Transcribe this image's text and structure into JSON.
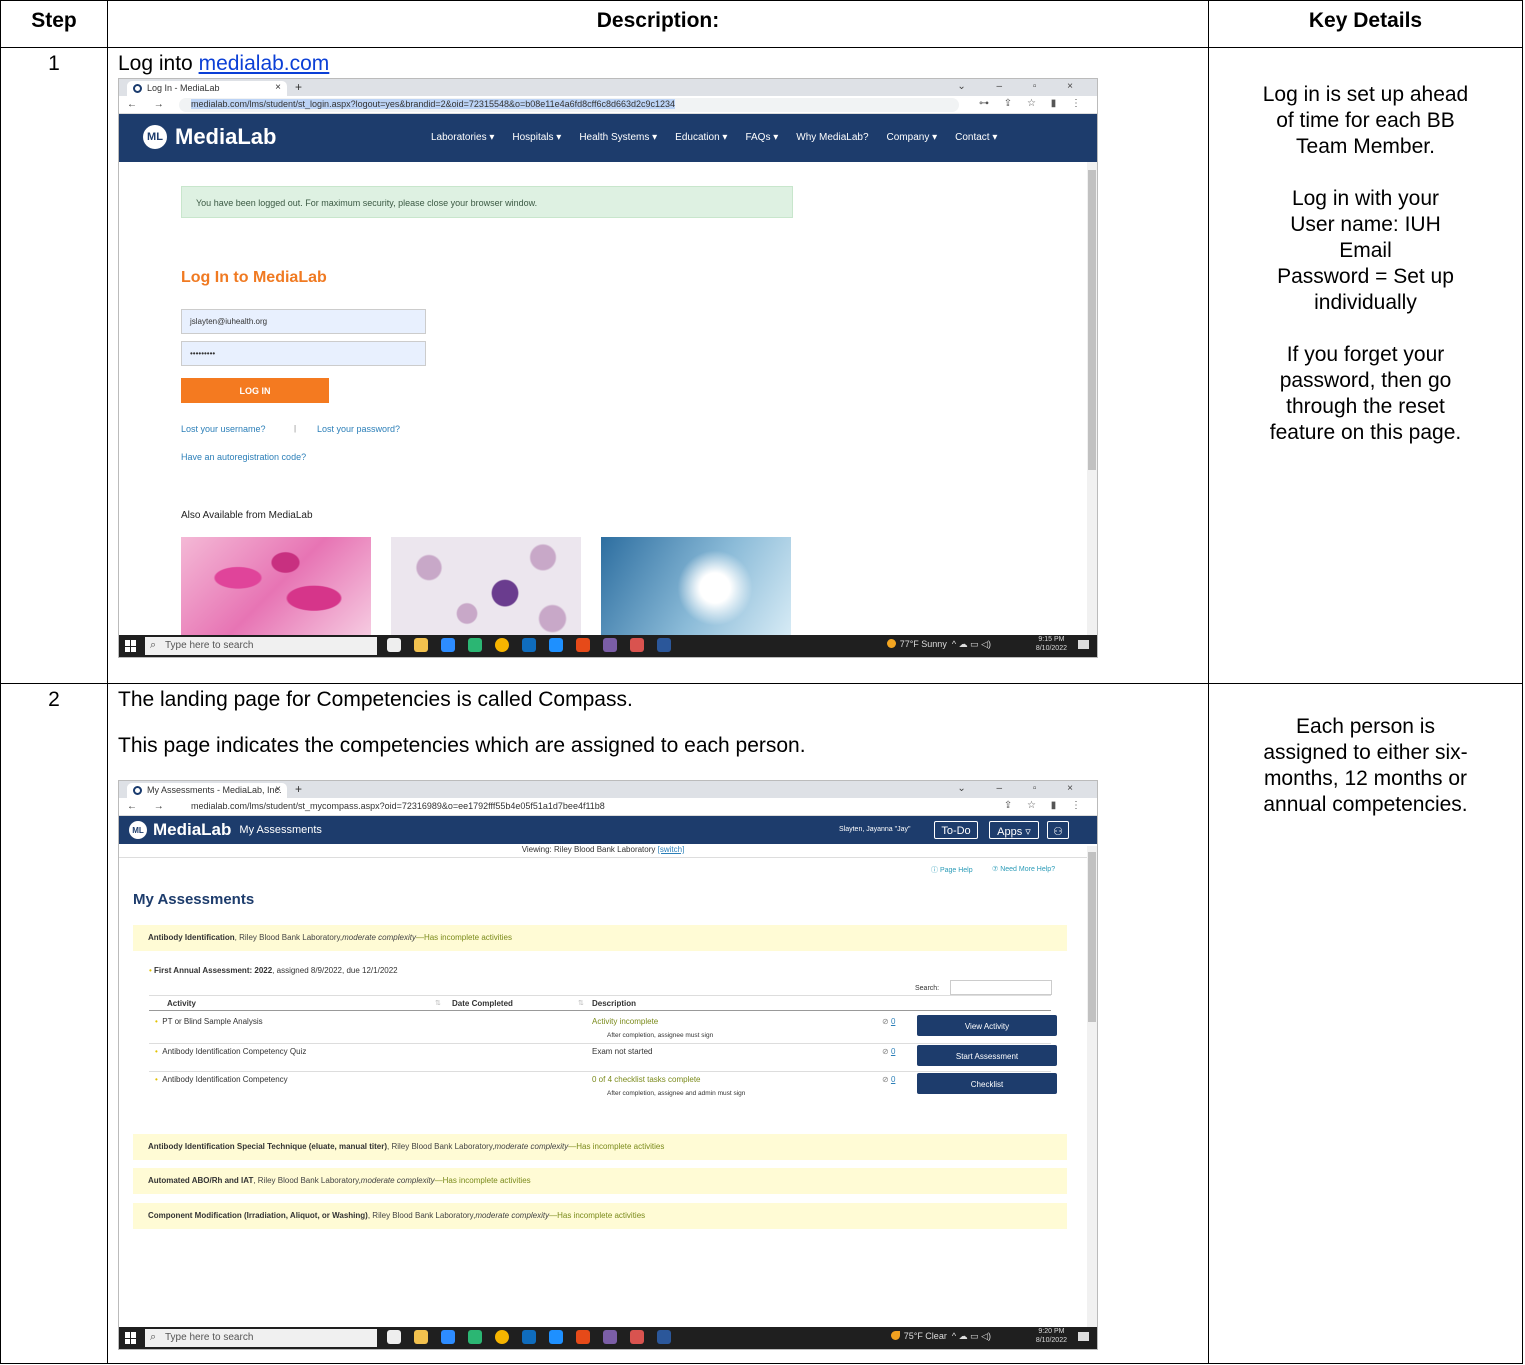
{
  "table": {
    "headers": {
      "step": "Step",
      "description": "Description:",
      "key_details": "Key Details"
    },
    "row1": {
      "step": "1",
      "intro_text": "Log into",
      "intro_link": "medialab.com",
      "key_details": [
        "Log in is set up ahead",
        "of time for each BB",
        "Team Member.",
        "",
        "Log in with your",
        "User name:   IUH",
        "Email",
        "Password = Set up",
        "individually",
        "",
        "If you forget your",
        "password, then go",
        "through the reset",
        "feature on this page."
      ]
    },
    "row2": {
      "step": "2",
      "line1": "The landing page for Competencies is called Compass.",
      "line2": "This page indicates the competencies which are assigned to each person.",
      "key_details": [
        "Each person is",
        "assigned to either six-",
        "months, 12 months or",
        "annual competencies."
      ]
    }
  },
  "shot1": {
    "tab_title": "Log In - MediaLab",
    "tab_close": "×",
    "new_tab": "+",
    "window_controls": "⌄ – ▫ ×",
    "nav_buttons": "← → C",
    "url": "medialab.com/lms/student/st_login.aspx?logout=yes&brandid=2&oid=72315548&o=b08e11e4a6fd8cff6c8d663d2c9c1234",
    "addr_icons": "⊶ ⇪ ☆ ▮ ⋮",
    "logo_mark": "ML",
    "logo_text": "MediaLab",
    "menu": [
      "Laboratories ▾",
      "Hospitals ▾",
      "Health Systems ▾",
      "Education ▾",
      "FAQs ▾",
      "Why MediaLab?",
      "Company ▾",
      "Contact ▾"
    ],
    "alert": "You have been logged out. For maximum security, please close your browser window.",
    "login_title": "Log In to MediaLab",
    "username_value": "jslayten@iuhealth.org",
    "password_value": "•••••••••",
    "login_button": "LOG IN",
    "lost_username": "Lost your username?",
    "separator": "|",
    "lost_password": "Lost your password?",
    "autoreg": "Have an autoregistration code?",
    "also_available": "Also Available from MediaLab",
    "taskbar_search": "Type here to search",
    "search_glyph": "⌕",
    "weather": "77°F  Sunny",
    "tray_icons": "^ ☁ ▭ ◁)",
    "time": "9:15 PM",
    "date": "8/10/2022"
  },
  "shot2": {
    "tab_title": "My Assessments - MediaLab, Inc.",
    "tab_close": "×",
    "new_tab": "+",
    "window_controls": "⌄ – ▫ ×",
    "nav_buttons": "← → C",
    "url": "medialab.com/lms/student/st_mycompass.aspx?oid=72316989&o=ee1792fff55b4e05f51a1d7bee4f11b8",
    "addr_icons": "⇪ ☆ ▮ ⋮",
    "logo_mark": "ML",
    "logo_text": "MediaLab",
    "page_name": "My Assessments",
    "user_name": "Slayten, Jayanna \"Jay\"",
    "todo_button": "To-Do",
    "apps_button": "Apps ▿",
    "user_icon": "⚇",
    "viewing": "Viewing: Riley Blood Bank Laboratory",
    "switch": "[switch]",
    "page_help": "ⓘ Page Help",
    "need_help": "⑦ Need More Help?",
    "title": "My Assessments",
    "sections": [
      {
        "name": "Antibody Identification",
        "lab": ", Riley Blood Bank Laboratory,",
        "complexity": "moderate complexity",
        "status": "—Has incomplete activities"
      },
      {
        "name": "Antibody Identification Special Technique (eluate, manual titer)",
        "lab": ", Riley Blood Bank Laboratory,",
        "complexity": "moderate complexity",
        "status": "—Has incomplete activities"
      },
      {
        "name": "Automated ABO/Rh and IAT",
        "lab": ", Riley Blood Bank Laboratory,",
        "complexity": "moderate complexity",
        "status": "—Has incomplete activities"
      },
      {
        "name": "Component Modification (Irradiation, Aliquot, or Washing)",
        "lab": ", Riley Blood Bank Laboratory,",
        "complexity": "moderate complexity",
        "status": "—Has incomplete activities"
      }
    ],
    "assessment_name": "First Annual Assessment: 2022",
    "assessment_dates": ", assigned 8/9/2022, due 12/1/2022",
    "search_label": "Search:",
    "col_activity": "Activity",
    "col_date": "Date Completed",
    "col_desc": "Description",
    "rows": [
      {
        "activity": "PT or Blind Sample Analysis",
        "desc": "Activity incomplete",
        "note": "After completion, assignee must sign",
        "count": "0",
        "button": "View Activity"
      },
      {
        "activity": "Antibody Identification Competency Quiz",
        "desc": "Exam not started",
        "note": "",
        "count": "0",
        "button": "Start Assessment"
      },
      {
        "activity": "Antibody Identification Competency",
        "desc": "0 of 4 checklist tasks complete",
        "note": "After completion, assignee and admin must sign",
        "count": "0",
        "button": "Checklist"
      }
    ],
    "clip_glyph": "⊘",
    "sort_glyph": "⇅",
    "taskbar_search": "Type here to search",
    "search_glyph": "⌕",
    "weather": "75°F  Clear",
    "tray_icons": "^ ☁ ▭ ◁)",
    "time": "9:20 PM",
    "date": "8/10/2022"
  }
}
